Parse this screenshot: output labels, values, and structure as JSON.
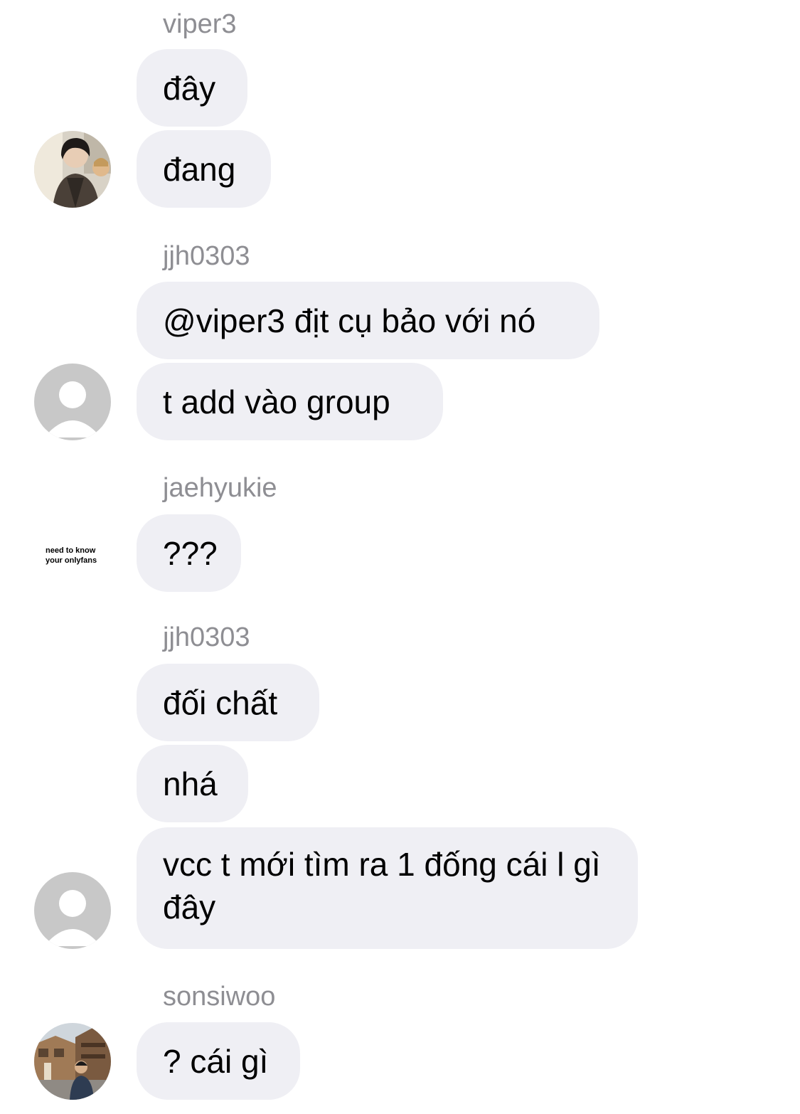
{
  "messages": [
    {
      "username": "viper3",
      "bubbles": [
        "đây",
        "đang"
      ],
      "avatar": "profile-photo-avatar"
    },
    {
      "username": "jjh0303",
      "bubbles": [
        "@viper3 địt cụ bảo với nó",
        "t add vào group"
      ],
      "avatar": "default-person-avatar"
    },
    {
      "username": "jaehyukie",
      "bubbles": [
        "???"
      ],
      "avatar": "text-avatar",
      "avatar_text": [
        "need to know",
        "your onlyfans"
      ]
    },
    {
      "username": "jjh0303",
      "bubbles": [
        "đối chất",
        "nhá",
        "vcc t mới tìm ra 1 đống cái l gì đây"
      ],
      "avatar": "default-person-avatar"
    },
    {
      "username": "sonsiwoo",
      "bubbles": [
        "? cái gì"
      ],
      "avatar": "street-photo-avatar"
    }
  ],
  "colors": {
    "bubble_background": "#efeff4",
    "username_text": "#8e8e93",
    "message_text": "#000000",
    "default_avatar_background": "#c8c8c8"
  }
}
